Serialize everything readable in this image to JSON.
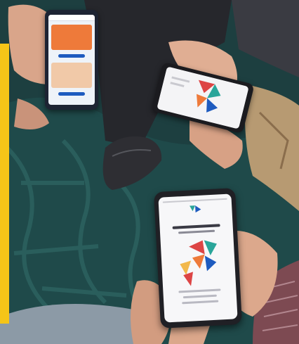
{
  "photo": {
    "subject": "hands-holding-phones",
    "accent_color": "#f5c518",
    "palette": {
      "floor": "#1f4a4a",
      "floor_pattern": "#2d6361",
      "clothing_dark": "#2a2b30",
      "skin": "#d9a58a",
      "brand_blue": "#1e5bbf",
      "brand_orange": "#ee7a3a",
      "brand_red": "#dd4545",
      "brand_teal": "#2aa59a"
    }
  }
}
